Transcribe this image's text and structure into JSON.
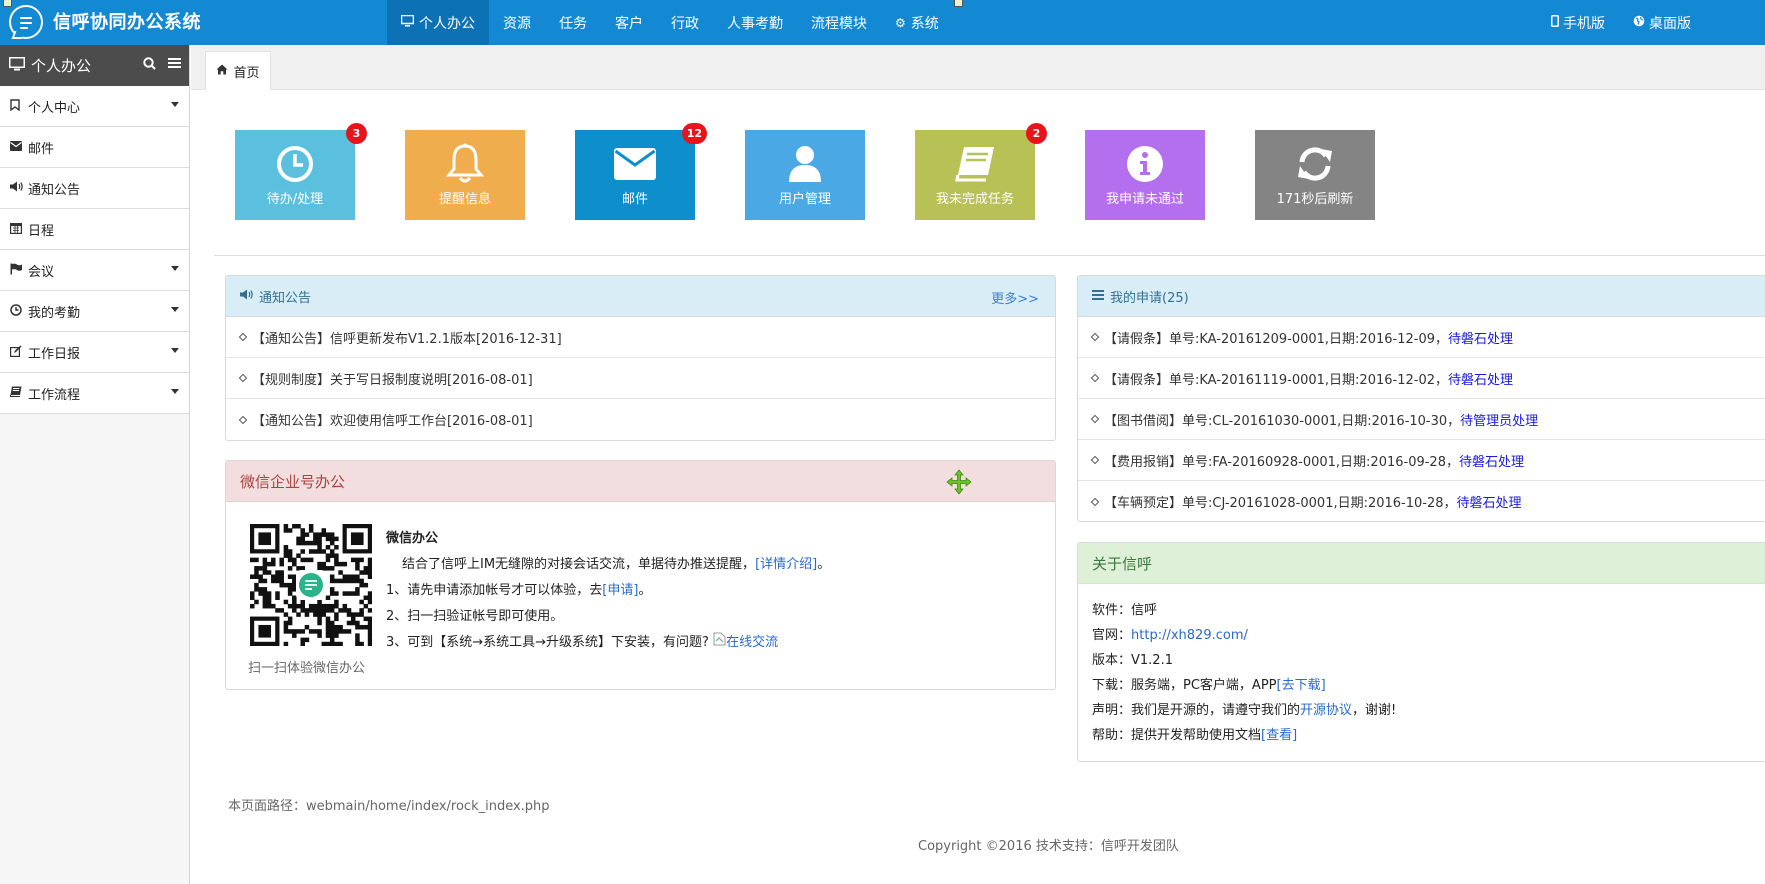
{
  "app": {
    "title": "信呼协同办公系统"
  },
  "nav": {
    "items": [
      {
        "label": "个人办公",
        "icon": "monitor-icon"
      },
      {
        "label": "资源"
      },
      {
        "label": "任务"
      },
      {
        "label": "客户"
      },
      {
        "label": "行政"
      },
      {
        "label": "人事考勤"
      },
      {
        "label": "流程模块"
      },
      {
        "label": "系统",
        "icon": "gear-icon"
      }
    ],
    "right": [
      {
        "label": "手机版",
        "icon": "mobile-icon"
      },
      {
        "label": "桌面版",
        "icon": "globe-icon"
      }
    ]
  },
  "sidebar": {
    "title": "个人办公",
    "items": [
      {
        "label": "个人中心",
        "icon": "bookmark-icon",
        "has_caret": true
      },
      {
        "label": "邮件",
        "icon": "envelope-icon",
        "has_caret": false
      },
      {
        "label": "通知公告",
        "icon": "volume-icon",
        "has_caret": false
      },
      {
        "label": "日程",
        "icon": "calendar-icon",
        "has_caret": false
      },
      {
        "label": "会议",
        "icon": "flag-icon",
        "has_caret": true
      },
      {
        "label": "我的考勤",
        "icon": "clock-icon",
        "has_caret": true
      },
      {
        "label": "工作日报",
        "icon": "edit-icon",
        "has_caret": true
      },
      {
        "label": "工作流程",
        "icon": "book-icon",
        "has_caret": true
      }
    ]
  },
  "tabs": [
    {
      "label": "首页",
      "icon": "home-icon"
    }
  ],
  "tiles": [
    {
      "label": "待办/处理",
      "badge": "3",
      "icon": "clock-icon",
      "color": "#5bc0de"
    },
    {
      "label": "提醒信息",
      "badge": "",
      "icon": "bell-icon",
      "color": "#f0ad4e"
    },
    {
      "label": "邮件",
      "badge": "12",
      "icon": "envelope-icon",
      "color": "#0e8fcc"
    },
    {
      "label": "用户管理",
      "badge": "",
      "icon": "user-icon",
      "color": "#4aa8e4"
    },
    {
      "label": "我未完成任务",
      "badge": "2",
      "icon": "book-icon",
      "color": "#b7c155"
    },
    {
      "label": "我申请未通过",
      "badge": "",
      "icon": "info-icon",
      "color": "#b46fef"
    },
    {
      "label": "171秒后刷新",
      "badge": "",
      "icon": "refresh-icon",
      "color": "#848484"
    }
  ],
  "notices": {
    "title": "通知公告",
    "more": "更多>>",
    "items": [
      "【通知公告】信呼更新发布V1.2.1版本[2016-12-31]",
      "【规则制度】关于写日报制度说明[2016-08-01]",
      "【通知公告】欢迎使用信呼工作台[2016-08-01]"
    ]
  },
  "applications": {
    "title": "我的申请(25)",
    "items": [
      {
        "text": "【请假条】单号:KA-20161209-0001,日期:2016-12-09，",
        "status": "待磐石处理"
      },
      {
        "text": "【请假条】单号:KA-20161119-0001,日期:2016-12-02，",
        "status": "待磐石处理"
      },
      {
        "text": "【图书借阅】单号:CL-20161030-0001,日期:2016-10-30，",
        "status": "待管理员处理"
      },
      {
        "text": "【费用报销】单号:FA-20160928-0001,日期:2016-09-28，",
        "status": "待磐石处理"
      },
      {
        "text": "【车辆预定】单号:CJ-20161028-0001,日期:2016-10-28，",
        "status": "待磐石处理"
      }
    ]
  },
  "wechat": {
    "title": "微信企业号办公",
    "heading": "微信办公",
    "line0a": "结合了信呼上IM无缝隙的对接会话交流，单据待办推送提醒，",
    "line0_link": "[详情介绍]",
    "line0b": "。",
    "line1a": "1、请先申请添加帐号才可以体验，去",
    "line1_link": "[申请]",
    "line1b": "。",
    "line2": "2、扫一扫验证帐号即可使用。",
    "line3": "3、可到【系统→系统工具→升级系统】下安装，有问题?",
    "online": "在线交流",
    "qr_caption": "扫一扫体验微信办公"
  },
  "about": {
    "title": "关于信呼",
    "software_label": "软件：",
    "software": "信呼",
    "site_label": "官网：",
    "site": "http://xh829.com/",
    "version_label": "版本：",
    "version": "V1.2.1",
    "download_label": "下载：",
    "download": "服务端，PC客户端，APP",
    "download_link": "[去下载]",
    "statement_label": "声明：",
    "statement_a": "我们是开源的，请遵守我们的",
    "statement_link": "开源协议",
    "statement_b": "，谢谢!",
    "help_label": "帮助：",
    "help": "提供开发帮助使用文档",
    "help_link": "[查看]"
  },
  "footer": {
    "path": "本页面路径：webmain/home/index/rock_index.php",
    "copyright": "Copyright ©2016 技术支持：信呼开发团队"
  }
}
